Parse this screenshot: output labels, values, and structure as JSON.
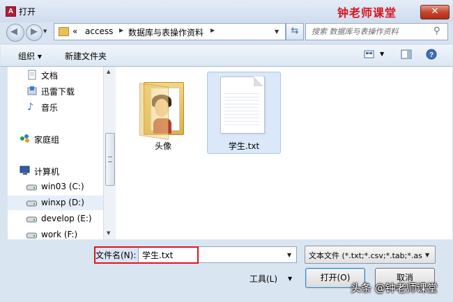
{
  "window": {
    "app_icon_letter": "A",
    "title": "打开",
    "watermark_title": "钟老师课堂",
    "close_glyph": "✕"
  },
  "address": {
    "overflow": "«",
    "crumbs": [
      "access",
      "数据库与表操作资料"
    ],
    "placeholder": "搜索 数据库与表操作资料"
  },
  "toolbar": {
    "organize": "组织 ▾",
    "new_folder": "新建文件夹"
  },
  "sidebar": {
    "items": [
      {
        "label": "文档",
        "icon": "document-icon"
      },
      {
        "label": "迅雷下载",
        "icon": "download-icon"
      },
      {
        "label": "音乐",
        "icon": "music-icon"
      },
      {
        "label": "家庭组",
        "icon": "homegroup-icon"
      },
      {
        "label": "计算机",
        "icon": "computer-icon"
      },
      {
        "label": "win03 (C:)",
        "icon": "drive-icon"
      },
      {
        "label": "winxp (D:)",
        "icon": "drive-icon"
      },
      {
        "label": "develop (E:)",
        "icon": "drive-icon"
      },
      {
        "label": "work (F:)",
        "icon": "drive-icon"
      }
    ],
    "selected_index": 6
  },
  "files": [
    {
      "label": "头像",
      "type": "folder",
      "selected": false
    },
    {
      "label": "学生.txt",
      "type": "text-file",
      "selected": true
    }
  ],
  "bottom": {
    "filename_label": "文件名(N):",
    "filename_value": "学生.txt",
    "filetype_value": "文本文件 (*.txt;*.csv;*.tab;*.asc)",
    "tools_label": "工具(L)",
    "open_label": "打开(O)",
    "cancel_label": "取消",
    "watermark": "头条 @钟老师课堂"
  },
  "colors": {
    "accent_red": "#d7131d",
    "selection": "#dbe8f9",
    "chrome": "#d9e4f1"
  }
}
